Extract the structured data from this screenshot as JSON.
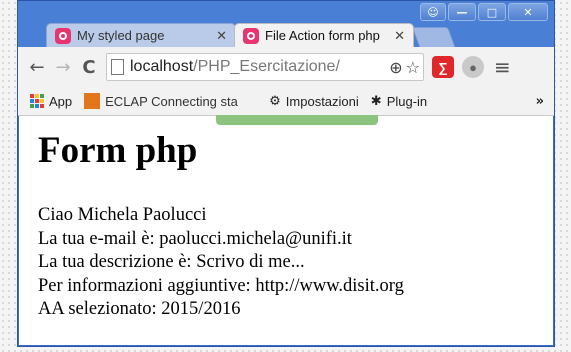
{
  "browser": {
    "tabs": [
      {
        "title": "My styled page",
        "active": false
      },
      {
        "title": "File Action form php",
        "active": true
      }
    ],
    "address": {
      "host": "localhost",
      "path": "/PHP_Esercitazione/"
    },
    "bookmarks": [
      {
        "label": "App",
        "icon": "apps-grid-icon"
      },
      {
        "label": "ECLAP Connecting sta",
        "icon": "eclap-icon"
      },
      {
        "label": "Impostazioni",
        "icon": "gear-icon"
      },
      {
        "label": "Plug-in",
        "icon": "puzzle-icon"
      }
    ],
    "overflow_label": "»",
    "colors": {
      "accent": "#3a6ec9",
      "favicon": "#e7356f",
      "ext_red": "#e0272b"
    }
  },
  "page": {
    "heading": "Form php",
    "lines": [
      "Ciao Michela Paolucci",
      "La tua e-mail è: paolucci.michela@unifi.it",
      "La tua descrizione è: Scrivo di me...",
      "Per informazioni aggiuntive: http://www.disit.org",
      "AA selezionato: 2015/2016"
    ]
  }
}
